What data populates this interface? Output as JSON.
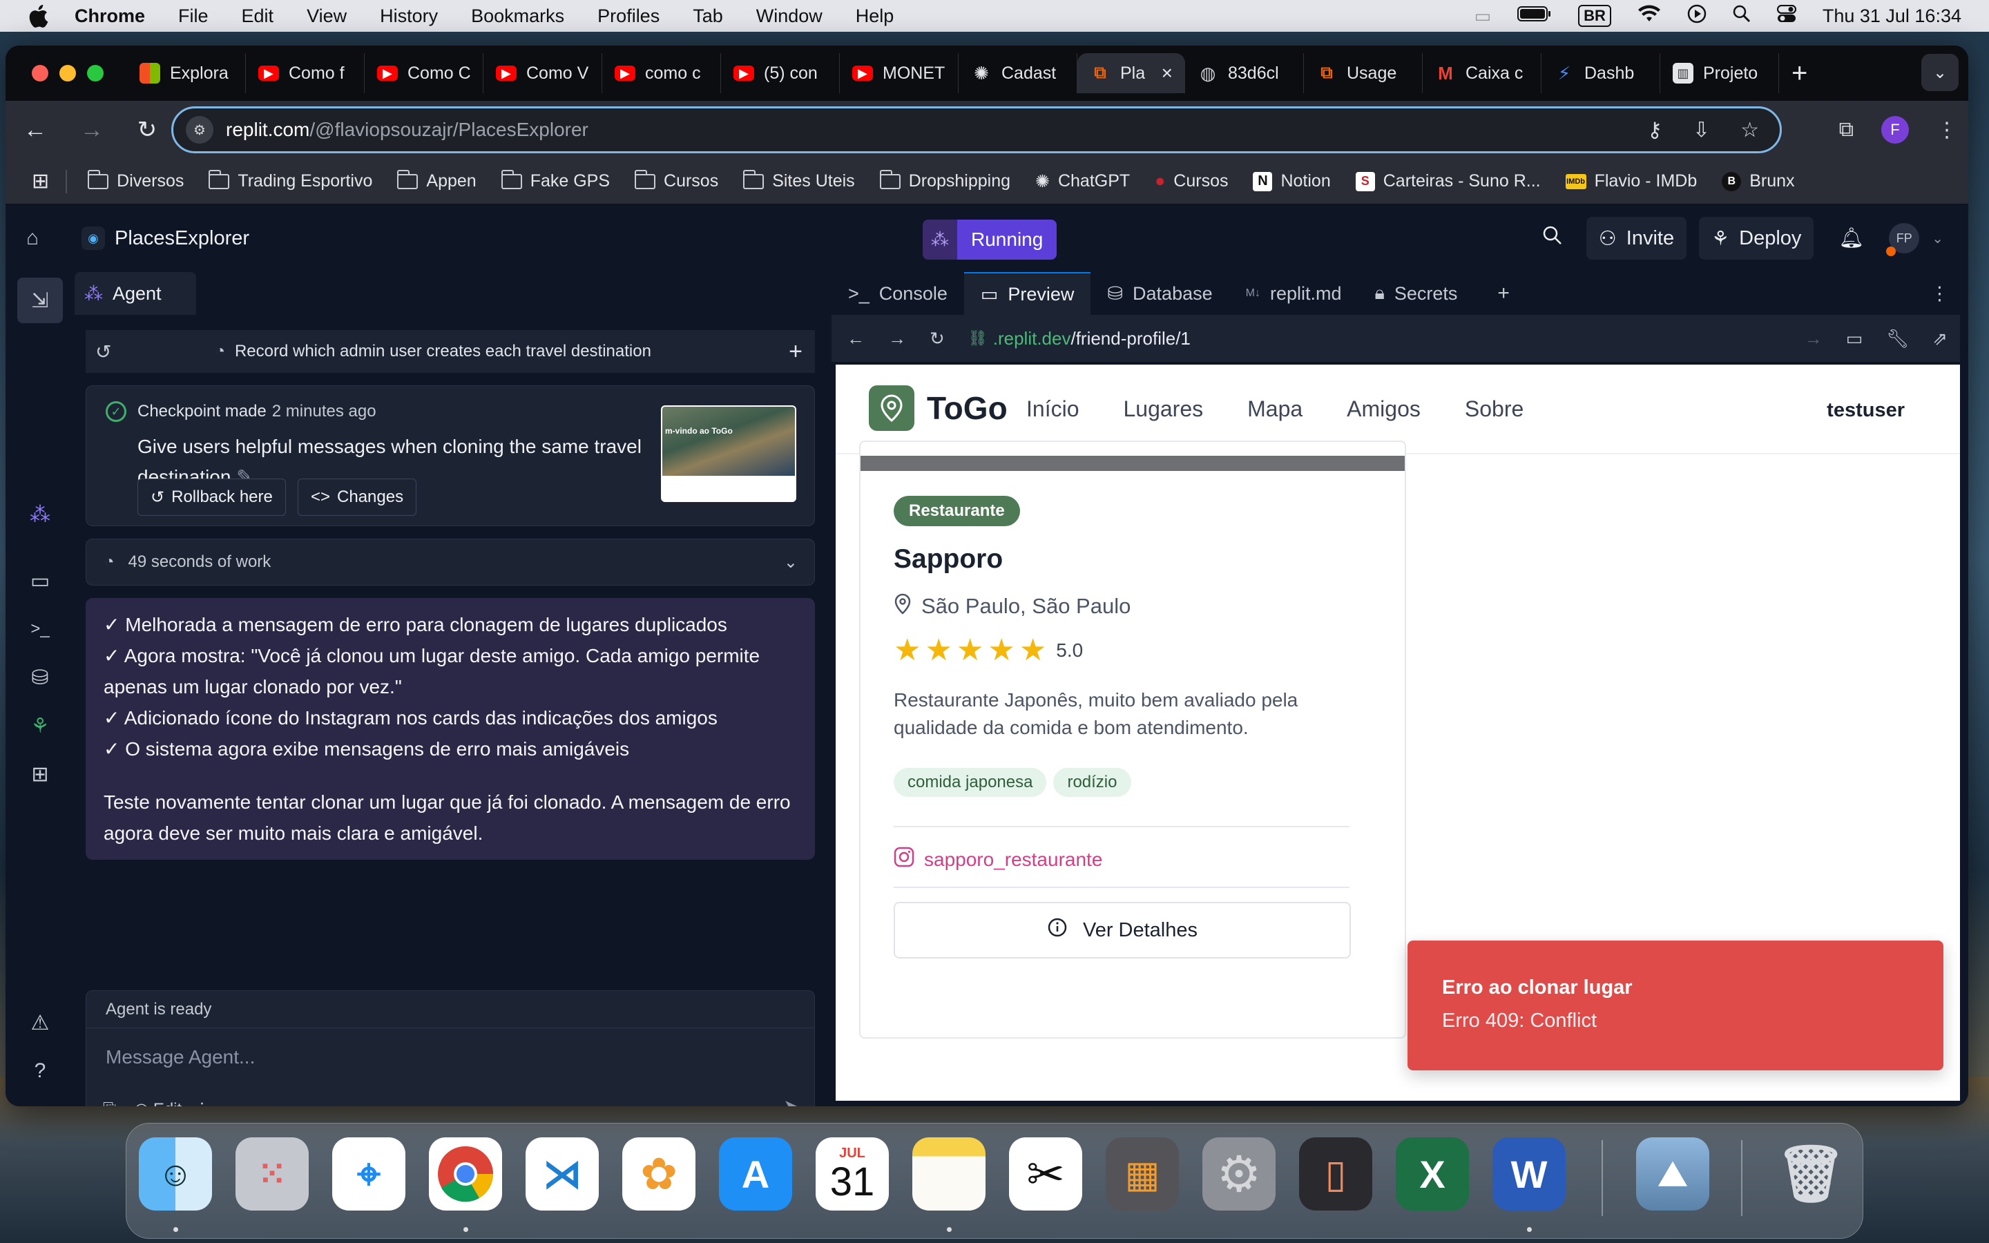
{
  "menubar": {
    "app": "Chrome",
    "items": [
      "File",
      "Edit",
      "View",
      "History",
      "Bookmarks",
      "Profiles",
      "Tab",
      "Window",
      "Help"
    ],
    "input_source": "BR",
    "clock": "Thu 31 Jul  16:34"
  },
  "browser": {
    "tabs": [
      {
        "label": "Explora",
        "icon": "microsoft-icon"
      },
      {
        "label": "Como f",
        "icon": "youtube-icon"
      },
      {
        "label": "Como C",
        "icon": "youtube-icon"
      },
      {
        "label": "Como V",
        "icon": "youtube-icon"
      },
      {
        "label": "como c",
        "icon": "youtube-icon"
      },
      {
        "label": "(5) con",
        "icon": "youtube-icon"
      },
      {
        "label": "MONET",
        "icon": "youtube-icon"
      },
      {
        "label": "Cadast",
        "icon": "openai-icon"
      },
      {
        "label": "Pla",
        "icon": "replit-icon",
        "active": true
      },
      {
        "label": "83d6cl",
        "icon": "globe-icon"
      },
      {
        "label": "Usage",
        "icon": "replit-icon"
      },
      {
        "label": "Caixa c",
        "icon": "gmail-icon"
      },
      {
        "label": "Dashb",
        "icon": "bolt-icon"
      },
      {
        "label": "Projeto",
        "icon": "trello-icon"
      }
    ],
    "url_host": "replit.com",
    "url_path": "/@flaviopsouzajr/PlacesExplorer",
    "profile_initial": "F",
    "bookmarks": [
      "Diversos",
      "Trading Esportivo",
      "Appen",
      "Fake GPS",
      "Cursos",
      "Sites Uteis",
      "Dropshipping",
      "ChatGPT",
      "Cursos",
      "Notion",
      "Carteiras - Suno R...",
      "Flavio - IMDb",
      "Brunx"
    ]
  },
  "replit": {
    "project": "PlacesExplorer",
    "status": "Running",
    "invite": "Invite",
    "deploy": "Deploy",
    "avatar": "FP",
    "agent_tab": "Agent",
    "history_title": "Record which admin user creates each travel destination",
    "checkpoint": {
      "label": "Checkpoint made",
      "time": "2 minutes ago",
      "title": "Give users helpful messages when cloning the same travel destination",
      "rollback": "Rollback here",
      "changes": "Changes",
      "thumb_text": "m-vindo ao ToGo"
    },
    "work": "49 seconds of work",
    "message": [
      "✓ Melhorada a mensagem de erro para clonagem de lugares duplicados",
      "✓ Agora mostra: \"Você já clonou um lugar deste amigo. Cada amigo permite apenas um lugar clonado por vez.\"",
      "✓ Adicionado ícone do Instagram nos cards das indicações dos amigos",
      "✓ O sistema agora exibe mensagens de erro mais amigáveis"
    ],
    "message_footer": "Teste novamente tentar clonar um lugar que já foi clonado. A mensagem de erro agora deve ser muito mais clara e amigável.",
    "agent_ready": "Agent is ready",
    "input_placeholder": "Message Agent...",
    "edit_label": "Edit",
    "pane_tabs": [
      "Console",
      "Preview",
      "Database",
      "replit.md",
      "Secrets"
    ],
    "preview_url_host": ".replit.dev",
    "preview_url_path": "/friend-profile/1"
  },
  "site": {
    "brand": "ToGo",
    "nav": [
      "Início",
      "Lugares",
      "Mapa",
      "Amigos",
      "Sobre"
    ],
    "user": "testuser",
    "place": {
      "category": "Restaurante",
      "name": "Sapporo",
      "location": "São Paulo, São Paulo",
      "rating": 5,
      "rating_text": "5.0",
      "description": "Restaurante Japonês, muito bem avaliado pela qualidade da comida e bom atendimento.",
      "tags": [
        "comida japonesa",
        "rodízio"
      ],
      "instagram": "sapporo_restaurante",
      "details_button": "Ver Detalhes"
    },
    "toast": {
      "title": "Erro ao clonar lugar",
      "message": "Erro 409: Conflict",
      "color": "#df4b49"
    }
  },
  "dock": {
    "calendar_month": "JUL",
    "calendar_day": "31"
  }
}
